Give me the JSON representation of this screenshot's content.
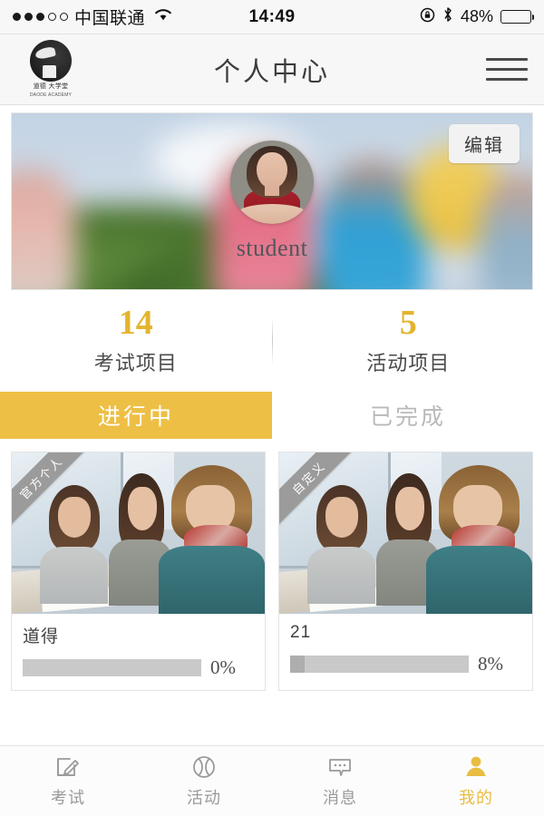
{
  "statusbar": {
    "carrier": "中国联通",
    "signal_dots_filled": 3,
    "signal_dots_total": 5,
    "wifi_icon": "wifi-icon",
    "time": "14:49",
    "rotation_lock_icon": "rotation-lock-icon",
    "bluetooth_icon": "bluetooth-icon",
    "battery_percent": "48%",
    "battery_level": 48
  },
  "header": {
    "logo_icon": "academy-logo-icon",
    "logo_cn": "道德 大学堂",
    "logo_en": "DAODE  ACADEMY",
    "title": "个人中心",
    "menu_icon": "hamburger-menu-icon"
  },
  "banner": {
    "edit_label": "编辑",
    "avatar_icon": "user-avatar",
    "username": "student"
  },
  "stats": [
    {
      "value": "14",
      "label": "考试项目"
    },
    {
      "value": "5",
      "label": "活动项目"
    }
  ],
  "tabs": [
    {
      "label": "进行中",
      "active": true
    },
    {
      "label": "已完成",
      "active": false
    }
  ],
  "cards": [
    {
      "ribbon": "官方个人",
      "title": "道得",
      "percent_label": "0%",
      "percent_value": 0
    },
    {
      "ribbon": "自定义",
      "title": "21",
      "percent_label": "8%",
      "percent_value": 8
    }
  ],
  "bottom_nav": [
    {
      "label": "考试",
      "icon": "exam-pencil-icon",
      "active": false
    },
    {
      "label": "活动",
      "icon": "activity-ball-icon",
      "active": false
    },
    {
      "label": "消息",
      "icon": "message-bubble-icon",
      "active": false
    },
    {
      "label": "我的",
      "icon": "profile-person-icon",
      "active": true
    }
  ],
  "colors": {
    "accent_gold": "#edbf45",
    "stat_gold": "#e3b52e",
    "inactive_gray": "#b9b9b9",
    "nav_gray": "#9a9a9a"
  }
}
